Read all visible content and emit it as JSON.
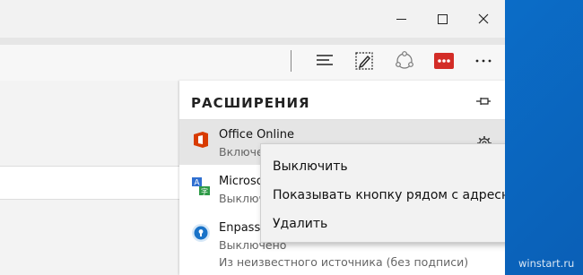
{
  "toolbar": {
    "icons": [
      "hub-icon",
      "web-note-icon",
      "share-icon",
      "lastpass-icon",
      "more-icon"
    ]
  },
  "extensions_panel": {
    "title": "РАСШИРЕНИЯ",
    "items": [
      {
        "name": "Office Online",
        "status": "Включе",
        "icon": "office-icon"
      },
      {
        "name": "Microso",
        "status": "Выключ",
        "icon": "translator-icon"
      },
      {
        "name": "Enpass P",
        "status": "Выключено",
        "source": "Из неизвестного источника (без подписи)",
        "icon": "enpass-icon"
      }
    ]
  },
  "context_menu": {
    "items": [
      {
        "label": "Выключить"
      },
      {
        "label": "Показывать кнопку рядом с адресной строкой"
      },
      {
        "label": "Удалить"
      }
    ]
  },
  "watermark": "winstart.ru",
  "colors": {
    "desktop": "#0a78d4",
    "office": "#d83b01",
    "lastpass": "#d32d27",
    "translator_blue": "#2f6fd0",
    "translator_green": "#2e9a47",
    "enpass": "#1a73c8"
  }
}
